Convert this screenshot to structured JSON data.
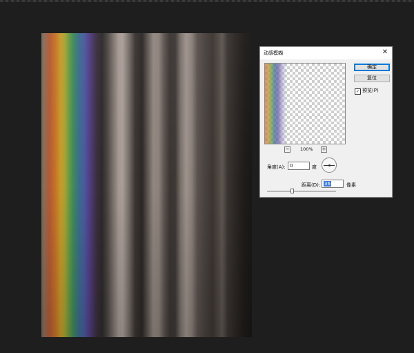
{
  "dialog": {
    "title": "动感模糊",
    "close_glyph": "✕",
    "ok_label": "确定",
    "reset_label": "复位",
    "preview_label": "预览(P)",
    "preview_checked": true,
    "check_glyph": "✓",
    "zoom": {
      "minus": "−",
      "plus": "+",
      "value": "100%"
    },
    "angle": {
      "label": "角度(A):",
      "value": "0",
      "unit": "度"
    },
    "distance": {
      "label": "距离(D):",
      "value": "36",
      "unit": "像素",
      "slider_fraction": 0.36
    }
  }
}
